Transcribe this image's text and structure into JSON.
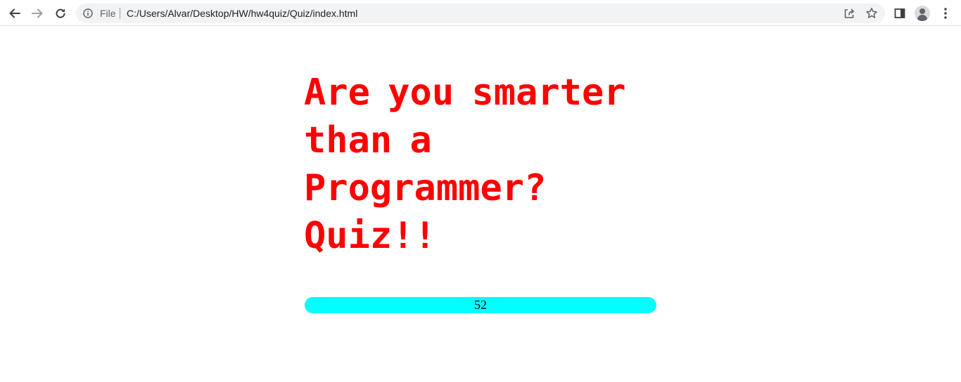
{
  "browser": {
    "scheme_label": "File",
    "url": "C:/Users/Alvar/Desktop/HW/hw4quiz/Quiz/index.html",
    "icons": {
      "back": "arrow-left-icon",
      "forward": "arrow-right-icon",
      "reload": "reload-icon",
      "site_info": "info-icon",
      "share": "share-icon",
      "bookmark": "star-icon",
      "side_panel": "side-panel-icon",
      "profile": "avatar",
      "menu": "kebab-menu-icon"
    }
  },
  "page": {
    "title": "Are you smarter than a Programmer? Quiz!!",
    "timer_value": "52",
    "colors": {
      "title": "#ff0000",
      "timer_bar": "#00ffff"
    }
  }
}
